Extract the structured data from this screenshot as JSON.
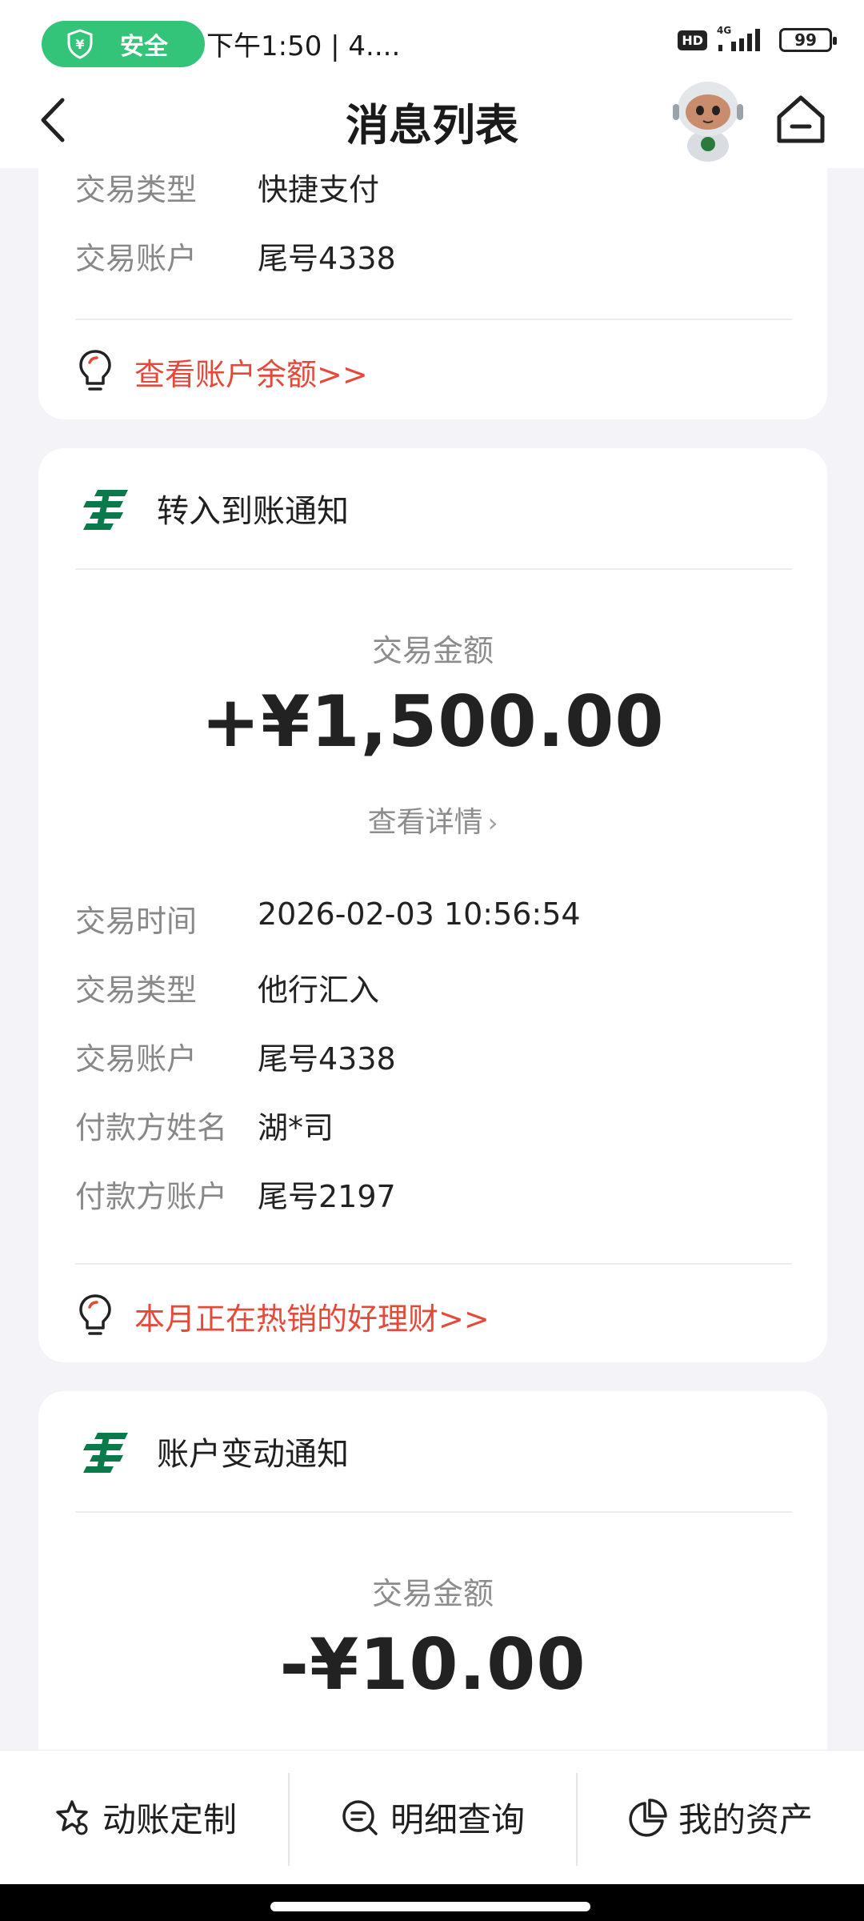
{
  "status_bar": {
    "safe_label": "安全",
    "time_text": "下午1:50 | 4....",
    "hd_label": "HD",
    "network_label": "4G",
    "battery_level": "99"
  },
  "nav": {
    "title": "消息列表"
  },
  "cards": [
    {
      "rows": [
        {
          "key": "交易类型",
          "value": "快捷支付"
        },
        {
          "key": "交易账户",
          "value": "尾号4338"
        }
      ],
      "promo": "查看账户余额>>"
    },
    {
      "title": "转入到账通知",
      "amount_label": "交易金额",
      "amount": "+¥1,500.00",
      "detail_link": "查看详情",
      "rows": [
        {
          "key": "交易时间",
          "value": "2026-02-03 10:56:54"
        },
        {
          "key": "交易类型",
          "value": "他行汇入"
        },
        {
          "key": "交易账户",
          "value": "尾号4338"
        },
        {
          "key": "付款方姓名",
          "value": "湖*司"
        },
        {
          "key": "付款方账户",
          "value": "尾号2197"
        }
      ],
      "promo": "本月正在热销的好理财>>"
    },
    {
      "title": "账户变动通知",
      "amount_label": "交易金额",
      "amount": "-¥10.00"
    }
  ],
  "tabs": [
    {
      "label": "动账定制",
      "icon": "star-settings-icon"
    },
    {
      "label": "明细查询",
      "icon": "search-list-icon"
    },
    {
      "label": "我的资产",
      "icon": "pie-chart-icon"
    }
  ],
  "colors": {
    "safe_green": "#33c47a",
    "promo_red": "#e5493a",
    "logo_green": "#0a7a4a"
  }
}
